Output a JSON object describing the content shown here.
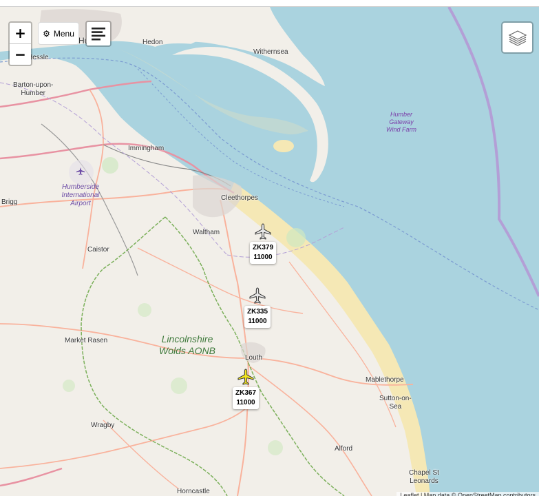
{
  "controls": {
    "zoom_in": "+",
    "zoom_out": "−",
    "menu_label": "Menu",
    "menu_icon": "gear-icon",
    "list_icon": "list-icon",
    "layers_icon": "layers-icon"
  },
  "places": {
    "hull": "Hull",
    "hessle": "Hessle",
    "hedon": "Hedon",
    "withernsea": "Withernsea",
    "barton": "Barton-upon-\nHumber",
    "immingham": "Immingham",
    "brigg": "Brigg",
    "cleethorpes": "Cleethorpes",
    "waltham": "Waltham",
    "caistor": "Caistor",
    "market_rasen": "Market Rasen",
    "louth": "Louth",
    "mablethorpe": "Mablethorpe",
    "sutton": "Sutton-on-\nSea",
    "wragby": "Wragby",
    "alford": "Alford",
    "chapel": "Chapel St\nLeonards",
    "horncastle": "Horncastle"
  },
  "features": {
    "airport": "Humberside\nInternational\nAirport",
    "windfarm": "Humber\nGateway\nWind Farm",
    "aonb": "Lincolnshire\nWolds AONB"
  },
  "aircraft": [
    {
      "callsign": "ZK379",
      "altitude": "11000",
      "color": "#e6e6e6"
    },
    {
      "callsign": "ZK335",
      "altitude": "11000",
      "color": "#e6e6e6"
    },
    {
      "callsign": "ZK367",
      "altitude": "11000",
      "color": "#f4e61e"
    }
  ],
  "colors": {
    "sea": "#aad3df",
    "land": "#f2efe9",
    "motorway": "#e892a2",
    "primary_road": "#f9b29c",
    "boundary": "#b39fd6",
    "aonb_boundary": "#6ea84a"
  },
  "attribution": "Leaflet | Map data © OpenStreetMap contributors"
}
